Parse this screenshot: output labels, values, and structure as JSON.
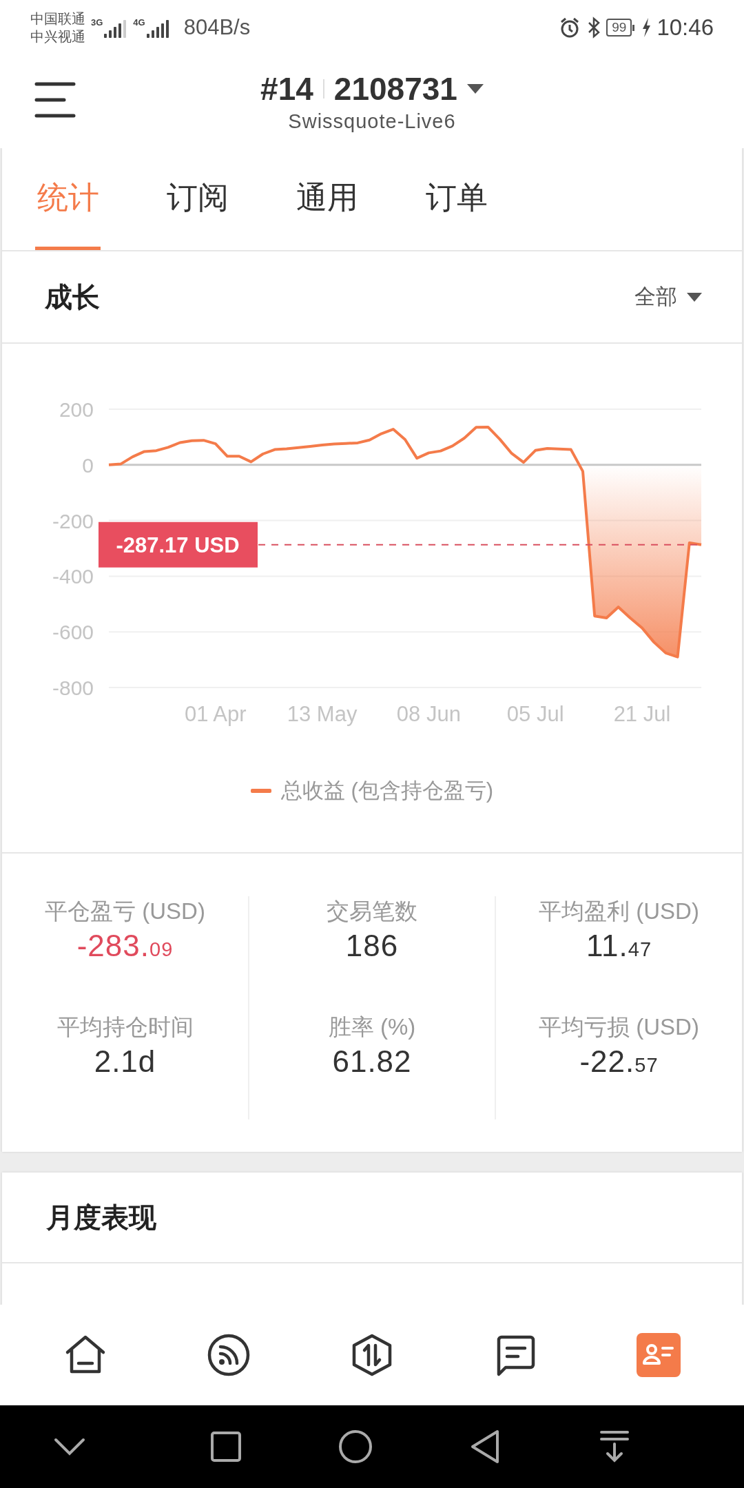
{
  "status_bar": {
    "carriers": [
      "中国联通",
      "中兴视通"
    ],
    "networks": [
      "3G",
      "4G"
    ],
    "speed": "804B/s",
    "battery": "99",
    "time": "10:46"
  },
  "header": {
    "account_number": "#14",
    "account_id": "2108731",
    "server": "Swissquote-Live6"
  },
  "tabs": [
    {
      "label": "统计",
      "selected": true
    },
    {
      "label": "订阅",
      "selected": false
    },
    {
      "label": "通用",
      "selected": false
    },
    {
      "label": "订单",
      "selected": false
    }
  ],
  "growth": {
    "title": "成长",
    "range": "全部",
    "chart_data": {
      "type": "line",
      "grid": true,
      "ylim": [
        -800,
        200
      ],
      "yticks": [
        200,
        0,
        -200,
        -400,
        -600,
        -800
      ],
      "categories": [
        null,
        null,
        null,
        null,
        null,
        null,
        null,
        null,
        null,
        "01 Apr",
        null,
        null,
        null,
        null,
        null,
        null,
        null,
        null,
        "13 May",
        null,
        null,
        null,
        null,
        null,
        null,
        null,
        null,
        "08 Jun",
        null,
        null,
        null,
        null,
        null,
        null,
        null,
        null,
        "05 Jul",
        null,
        null,
        null,
        null,
        null,
        null,
        null,
        null,
        "21 Jul",
        null,
        null,
        null,
        null,
        null
      ],
      "series": [
        {
          "name": "总收益 (包含持仓盈亏)",
          "color": "#f47b4a",
          "values": [
            0,
            3,
            29,
            48,
            51,
            63,
            80,
            87,
            88,
            76,
            31,
            31,
            11,
            39,
            55,
            58,
            62,
            66,
            71,
            75,
            77,
            79,
            89,
            112,
            128,
            91,
            24,
            43,
            50,
            68,
            96,
            135,
            136,
            92,
            41,
            9,
            52,
            59,
            57,
            55,
            -23,
            -543,
            -550,
            -511,
            -550,
            -586,
            -637,
            -676,
            -690,
            -280,
            -287
          ]
        }
      ],
      "annotations": [
        "-287.17 USD"
      ]
    }
  },
  "stats": [
    {
      "label": "平仓盈亏 (USD)",
      "value": "-283.$_{09}$",
      "emphasis": true
    },
    {
      "label": "交易笔数",
      "value": "186",
      "emphasis": false
    },
    {
      "label": "平均盈利 (USD)",
      "value": "11.$_{47}$",
      "emphasis": false
    },
    {
      "label": "平均持仓时间",
      "value": "2.1d",
      "emphasis": false
    },
    {
      "label": "胜率 (%)",
      "value": "61.82",
      "emphasis": false
    },
    {
      "label": "平均亏损 (USD)",
      "value": "-22.$_{57}$",
      "emphasis": false
    }
  ],
  "monthly": {
    "title": "月度表现"
  },
  "bottom_nav": [
    {
      "selected": false
    },
    {
      "selected": false
    },
    {
      "selected": false
    },
    {
      "selected": false
    },
    {
      "selected": true
    }
  ]
}
